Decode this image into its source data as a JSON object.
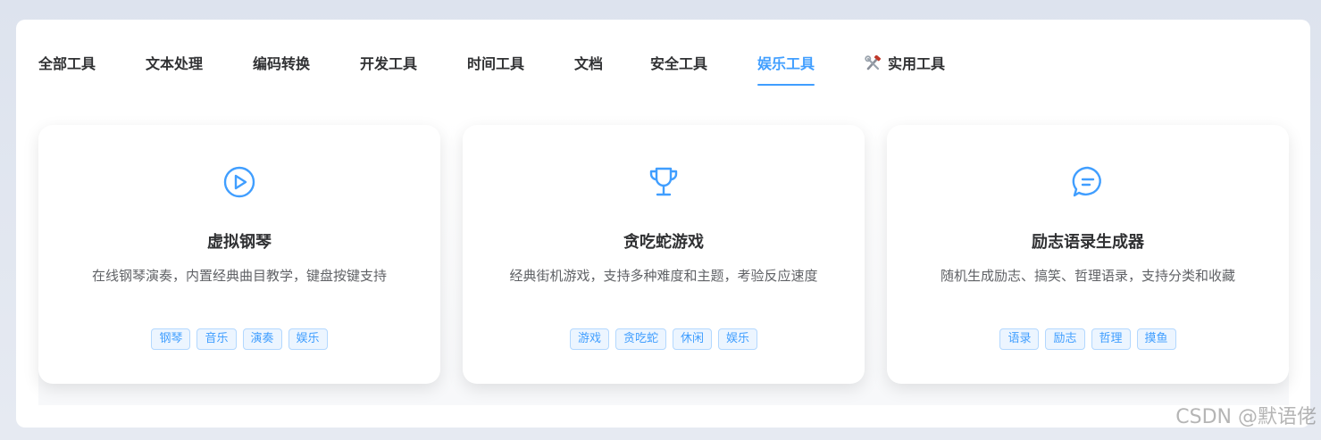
{
  "tabs": [
    {
      "label": "全部工具"
    },
    {
      "label": "文本处理"
    },
    {
      "label": "编码转换"
    },
    {
      "label": "开发工具"
    },
    {
      "label": "时间工具"
    },
    {
      "label": "文档"
    },
    {
      "label": "安全工具"
    },
    {
      "label": "娱乐工具",
      "active": true
    },
    {
      "label": "实用工具",
      "icon": "hammer-wrench-icon"
    }
  ],
  "cards": [
    {
      "icon": "play-circle-icon",
      "title": "虚拟钢琴",
      "description": "在线钢琴演奏，内置经典曲目教学，键盘按键支持",
      "tags": [
        "钢琴",
        "音乐",
        "演奏",
        "娱乐"
      ]
    },
    {
      "icon": "trophy-icon",
      "title": "贪吃蛇游戏",
      "description": "经典街机游戏，支持多种难度和主题，考验反应速度",
      "tags": [
        "游戏",
        "贪吃蛇",
        "休闲",
        "娱乐"
      ]
    },
    {
      "icon": "chat-bubble-icon",
      "title": "励志语录生成器",
      "description": "随机生成励志、搞笑、哲理语录，支持分类和收藏",
      "tags": [
        "语录",
        "励志",
        "哲理",
        "摸鱼"
      ]
    }
  ],
  "colors": {
    "accent": "#409eff",
    "text": "#303133",
    "muted": "#606266"
  },
  "watermark": "CSDN @默语佬"
}
